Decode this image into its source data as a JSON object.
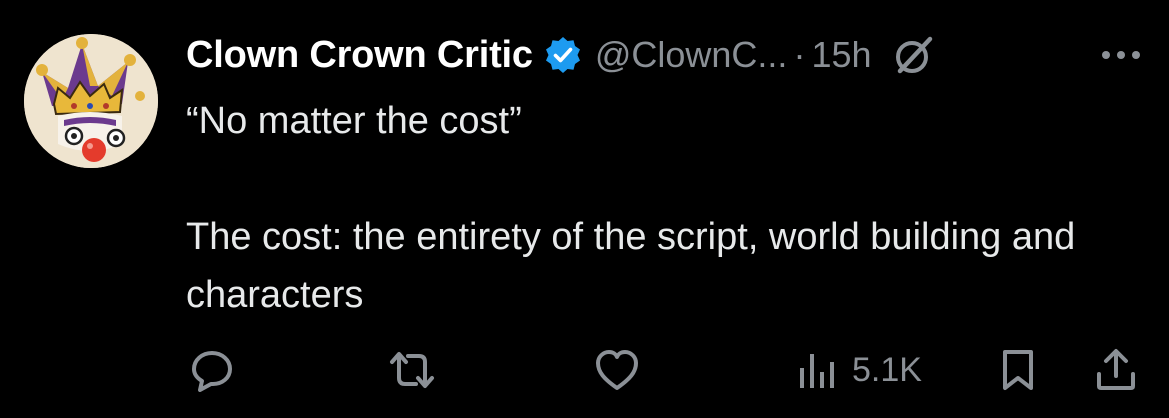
{
  "tweet": {
    "author": {
      "display_name": "Clown Crown Critic",
      "handle": "@ClownC...",
      "verified": true,
      "avatar_icon": "jester-clown-avatar"
    },
    "separator": "·",
    "time": "15h",
    "text": {
      "line1": "“No matter the cost”",
      "line2": "The cost: the entirety of the script, world building and characters"
    },
    "actions": {
      "reply_icon": "reply-icon",
      "retweet_icon": "retweet-icon",
      "like_icon": "like-icon",
      "views_icon": "views-icon",
      "views_count": "5.1K",
      "bookmark_icon": "bookmark-icon",
      "share_icon": "share-icon"
    }
  },
  "colors": {
    "background": "#000000",
    "text": "#e7e9ea",
    "secondary": "#8b9096",
    "verified_blue": "#1d9bf0"
  }
}
